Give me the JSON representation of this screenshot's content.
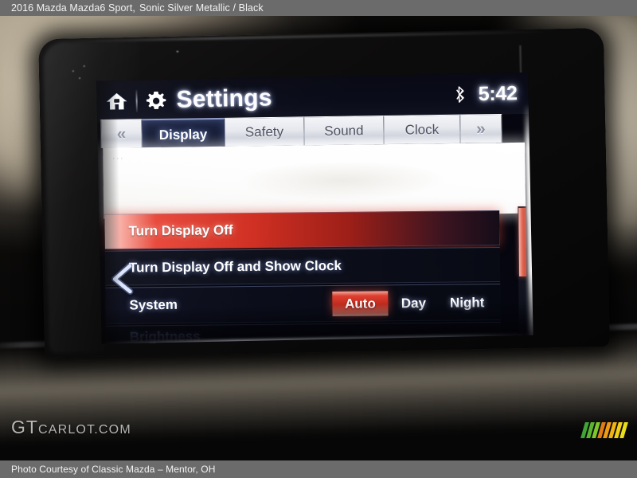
{
  "caption": {
    "vehicle_title": "2016 Mazda Mazda6 Sport,",
    "color_combo": "Sonic Silver Metallic / Black",
    "photo_credit": "Photo Courtesy of Classic Mazda – Mentor, OH"
  },
  "watermark": {
    "gt": "GT",
    "rest": "CARLOT.COM",
    "bar_colors": [
      "#3fa635",
      "#5cb531",
      "#7ec62e",
      "#e07c16",
      "#ef9a15",
      "#f0b214",
      "#f2cf14",
      "#e9dc18"
    ]
  },
  "infotainment": {
    "status_bar": {
      "home_icon": "home-icon",
      "gear_icon": "gear-icon",
      "title": "Settings",
      "bluetooth_icon": "bluetooth-icon",
      "clock": "5:42"
    },
    "tabs": [
      {
        "id": "prev",
        "label": "«",
        "type": "nav",
        "active": false
      },
      {
        "id": "display",
        "label": "Display",
        "type": "tab",
        "active": true
      },
      {
        "id": "safety",
        "label": "Safety",
        "type": "tab",
        "active": false
      },
      {
        "id": "sound",
        "label": "Sound",
        "type": "tab",
        "active": false
      },
      {
        "id": "clock",
        "label": "Clock",
        "type": "tab",
        "active": false
      },
      {
        "id": "next",
        "label": "»",
        "type": "nav",
        "active": false
      }
    ],
    "back_arrow_icon": "back-chevron-icon",
    "menu_rows": [
      {
        "id": "turn-display-off",
        "label": "Turn Display Off",
        "highlighted": true
      },
      {
        "id": "turn-display-off-show-clock",
        "label": "Turn Display Off and Show Clock",
        "highlighted": false
      },
      {
        "id": "system",
        "label": "System",
        "highlighted": false
      },
      {
        "id": "brightness",
        "label": "Brightness",
        "highlighted": false
      }
    ],
    "system_modes": [
      {
        "id": "auto",
        "label": "Auto",
        "selected": true
      },
      {
        "id": "day",
        "label": "Day",
        "selected": false
      },
      {
        "id": "night",
        "label": "Night",
        "selected": false
      }
    ],
    "colors": {
      "highlight_red": "#d43325",
      "panel_dark_blue": "#0c0e1a",
      "active_tab": "#141b35",
      "tab_face": "#e6e8ee"
    }
  }
}
